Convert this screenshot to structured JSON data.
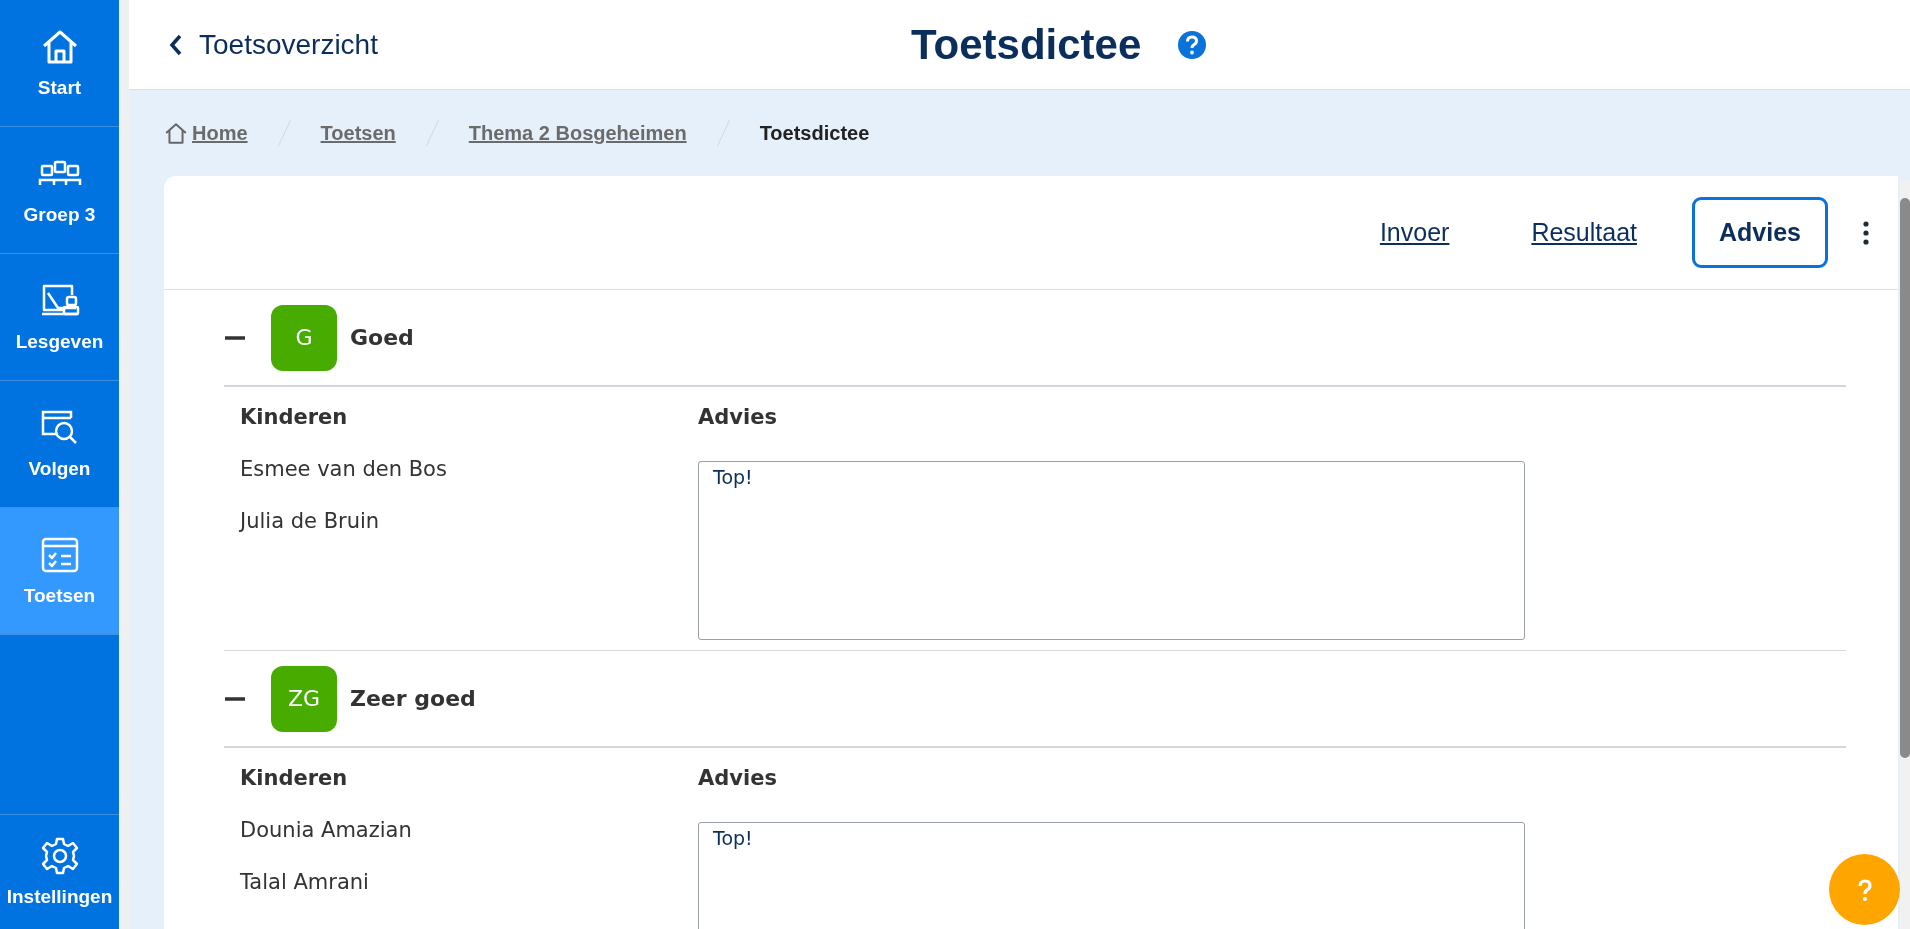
{
  "sidebar": {
    "items": [
      {
        "label": "Start",
        "kind": "home",
        "selected": false
      },
      {
        "label": "Groep 3",
        "kind": "group",
        "selected": false
      },
      {
        "label": "Lesgeven",
        "kind": "teach",
        "selected": false
      },
      {
        "label": "Volgen",
        "kind": "follow",
        "selected": false
      },
      {
        "label": "Toetsen",
        "kind": "tests",
        "selected": true
      }
    ],
    "bottom_item": {
      "label": "Instellingen"
    }
  },
  "header": {
    "back_link": "Toetsoverzicht",
    "title": "Toetsdictee"
  },
  "breadcrumbs": [
    {
      "label": "Home",
      "current": false
    },
    {
      "label": "Toetsen",
      "current": false
    },
    {
      "label": "Thema 2 Bosgeheimen",
      "current": false
    },
    {
      "label": "Toetsdictee",
      "current": true
    }
  ],
  "tabs": [
    {
      "label": "Invoer",
      "selected": false
    },
    {
      "label": "Resultaat",
      "selected": false
    },
    {
      "label": "Advies",
      "selected": true
    }
  ],
  "groups": [
    {
      "badge": "G",
      "title": "Goed",
      "expanded": true,
      "columns": [
        "Kinderen",
        "Advies"
      ],
      "students": [
        "Esmee van den Bos",
        "Julia de Bruin"
      ],
      "advice": "Top!"
    },
    {
      "badge": "ZG",
      "title": "Zeer goed",
      "expanded": true,
      "columns": [
        "Kinderen",
        "Advies"
      ],
      "students": [
        "Dounia Amazian",
        "Talal Amrani"
      ],
      "advice": "Top!"
    }
  ]
}
